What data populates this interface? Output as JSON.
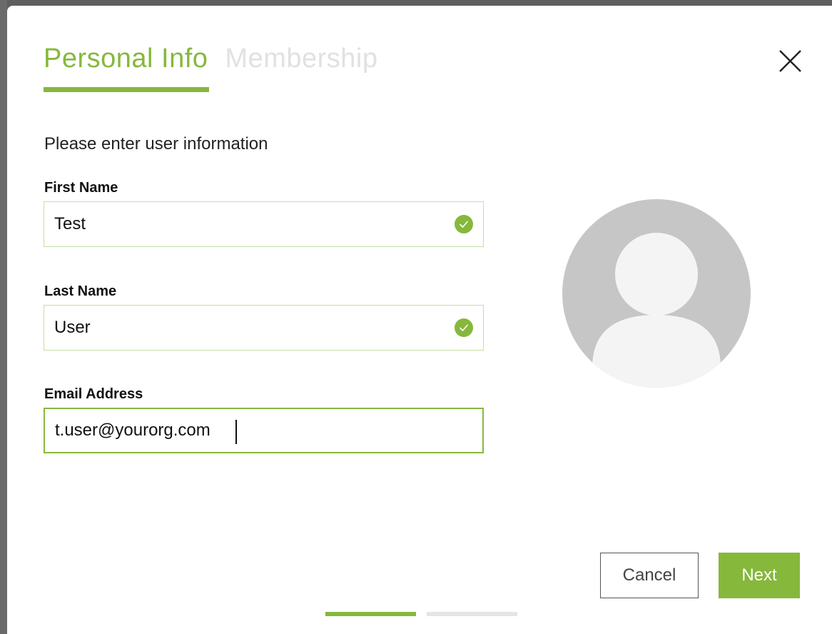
{
  "tabs": [
    {
      "label": "Personal Info",
      "active": true
    },
    {
      "label": "Membership",
      "active": false
    }
  ],
  "intro_text": "Please enter user information",
  "fields": {
    "first_name": {
      "label": "First Name",
      "value": "Test",
      "valid": true
    },
    "last_name": {
      "label": "Last Name",
      "value": "User",
      "valid": true
    },
    "email": {
      "label": "Email Address",
      "value": "t.user@yourorg.com",
      "focused": true
    }
  },
  "avatar": {
    "icon": "user-avatar-placeholder-icon"
  },
  "buttons": {
    "cancel": "Cancel",
    "next": "Next"
  },
  "steps": {
    "current": 1,
    "total": 2
  },
  "colors": {
    "accent": "#86b83c",
    "accent_light_border": "#c7dea3",
    "inactive_tab": "#e1e1e1",
    "inactive_step": "#e5e5e5",
    "avatar_gray": "#c6c6c6"
  },
  "icons": {
    "close": "close-icon",
    "valid": "checkmark-circle-icon"
  }
}
